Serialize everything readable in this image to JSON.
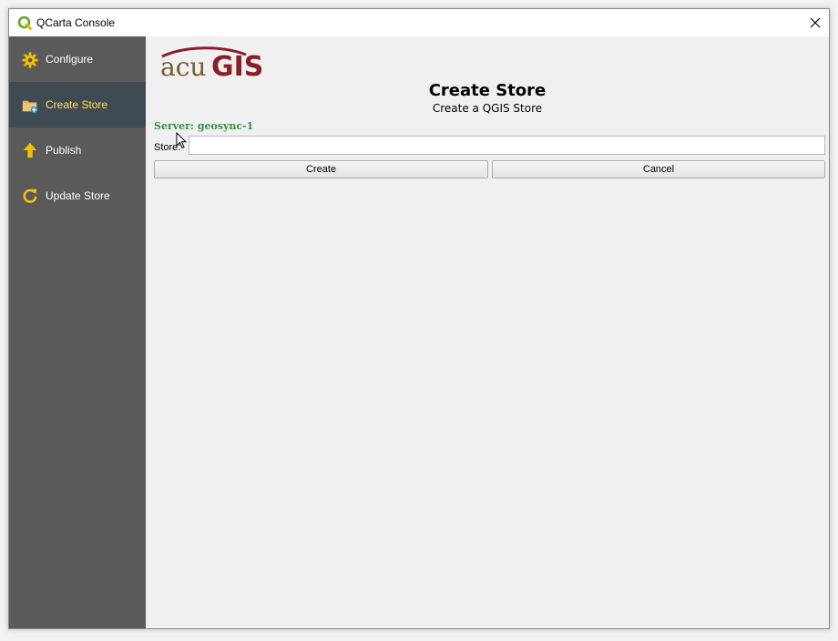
{
  "window": {
    "title": "QCarta Console"
  },
  "sidebar": {
    "items": [
      {
        "label": "Configure",
        "icon": "gear-icon",
        "active": false
      },
      {
        "label": "Create Store",
        "icon": "folder-add-icon",
        "active": true
      },
      {
        "label": "Publish",
        "icon": "arrow-up-icon",
        "active": false
      },
      {
        "label": "Update Store",
        "icon": "refresh-icon",
        "active": false
      }
    ]
  },
  "main": {
    "logo_text": "acuGIS",
    "title": "Create Store",
    "subtitle": "Create a QGIS Store",
    "server_label": "Server: geosync-1",
    "store_field": {
      "label": "Store:",
      "value": "",
      "placeholder": ""
    },
    "buttons": {
      "create": "Create",
      "cancel": "Cancel"
    }
  },
  "colors": {
    "sidebar_bg": "#5a5a5a",
    "sidebar_active_bg": "#3f4a53",
    "active_label": "#ffe14d",
    "icon_yellow": "#f2c200",
    "server_label": "#3a8c4a",
    "logo_brown": "#7a5a2a",
    "logo_red": "#8a1f2a"
  }
}
